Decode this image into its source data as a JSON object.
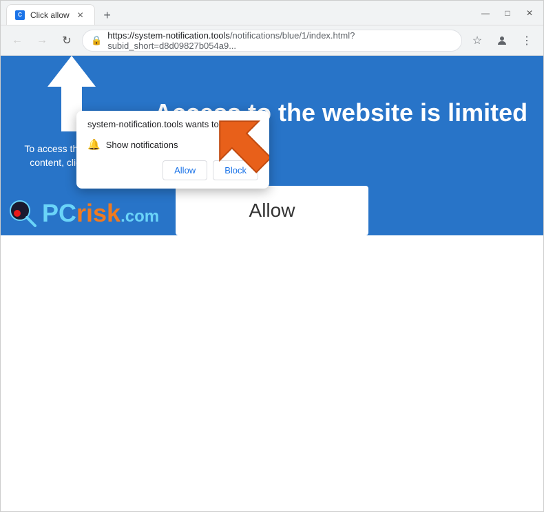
{
  "browser": {
    "tab": {
      "title": "Click allow",
      "favicon": "CA"
    },
    "window_controls": {
      "minimize": "—",
      "maximize": "□",
      "close": "✕"
    },
    "nav": {
      "back": "←",
      "forward": "→",
      "refresh": "↻"
    },
    "address_bar": {
      "url_highlighted": "https://system-notification.tools",
      "url_dimmed": "/notifications/blue/1/index.html?subid_short=d8d09827b054a9..."
    }
  },
  "popup": {
    "title": "system-notification.tools wants to",
    "close_btn": "×",
    "permission_label": "Show notifications",
    "allow_btn": "Allow",
    "block_btn": "Block"
  },
  "webpage": {
    "heading": "Access to the website is limited",
    "instruction": "To access the website content, click Allow!",
    "allow_button": "Allow"
  },
  "watermark": {
    "logo": "PC",
    "logo_risk": "risk",
    "logo_com": ".com"
  }
}
